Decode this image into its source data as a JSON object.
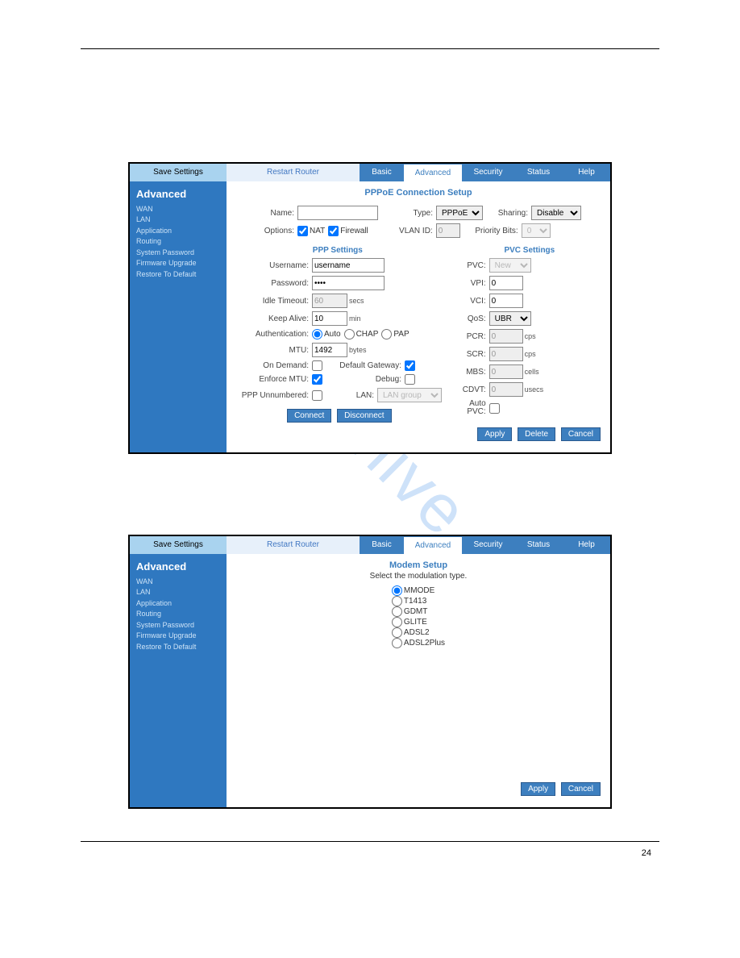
{
  "watermark": "manualshive.com",
  "pageNum": "24",
  "topbar": {
    "save": "Save Settings",
    "restart": "Restart Router",
    "basic": "Basic",
    "advanced": "Advanced",
    "security": "Security",
    "status": "Status",
    "help": "Help"
  },
  "sidebar": {
    "heading": "Advanced",
    "items": [
      "WAN",
      "LAN",
      "Application",
      "Routing",
      "System Password",
      "Firmware Upgrade",
      "Restore To Default"
    ]
  },
  "screen1": {
    "title": "PPPoE Connection Setup",
    "name_lbl": "Name:",
    "name_val": "",
    "type_lbl": "Type:",
    "type_val": "PPPoE",
    "sharing_lbl": "Sharing:",
    "sharing_val": "Disable",
    "options_lbl": "Options:",
    "opt_nat": "NAT",
    "opt_fw": "Firewall",
    "vlan_lbl": "VLAN ID:",
    "vlan_val": "0",
    "prio_lbl": "Priority Bits:",
    "prio_val": "0",
    "ppp_heading": "PPP Settings",
    "username_lbl": "Username:",
    "username_val": "username",
    "password_lbl": "Password:",
    "password_val": "••••",
    "idle_lbl": "Idle Timeout:",
    "idle_val": "60",
    "idle_unit": "secs",
    "keep_lbl": "Keep Alive:",
    "keep_val": "10",
    "keep_unit": "min",
    "auth_lbl": "Authentication:",
    "auth_auto": "Auto",
    "auth_chap": "CHAP",
    "auth_pap": "PAP",
    "mtu_lbl": "MTU:",
    "mtu_val": "1492",
    "mtu_unit": "bytes",
    "ondemand_lbl": "On Demand:",
    "defgw_lbl": "Default Gateway:",
    "enforce_lbl": "Enforce MTU:",
    "debug_lbl": "Debug:",
    "pppun_lbl": "PPP Unnumbered:",
    "lan_lbl": "LAN:",
    "lan_val": "LAN group",
    "pvc_heading": "PVC Settings",
    "pvc_lbl": "PVC:",
    "pvc_val": "New",
    "vpi_lbl": "VPI:",
    "vpi_val": "0",
    "vci_lbl": "VCI:",
    "vci_val": "0",
    "qos_lbl": "QoS:",
    "qos_val": "UBR",
    "pcr_lbl": "PCR:",
    "pcr_val": "0",
    "pcr_unit": "cps",
    "scr_lbl": "SCR:",
    "scr_val": "0",
    "scr_unit": "cps",
    "mbs_lbl": "MBS:",
    "mbs_val": "0",
    "mbs_unit": "cells",
    "cdvt_lbl": "CDVT:",
    "cdvt_val": "0",
    "cdvt_unit": "usecs",
    "autopvc_lbl": "Auto PVC:",
    "btn_connect": "Connect",
    "btn_disconnect": "Disconnect",
    "btn_apply": "Apply",
    "btn_delete": "Delete",
    "btn_cancel": "Cancel"
  },
  "screen2": {
    "title": "Modem Setup",
    "subtitle": "Select the modulation type.",
    "opts": [
      "MMODE",
      "T1413",
      "GDMT",
      "GLITE",
      "ADSL2",
      "ADSL2Plus"
    ],
    "selected": "MMODE",
    "btn_apply": "Apply",
    "btn_cancel": "Cancel"
  }
}
